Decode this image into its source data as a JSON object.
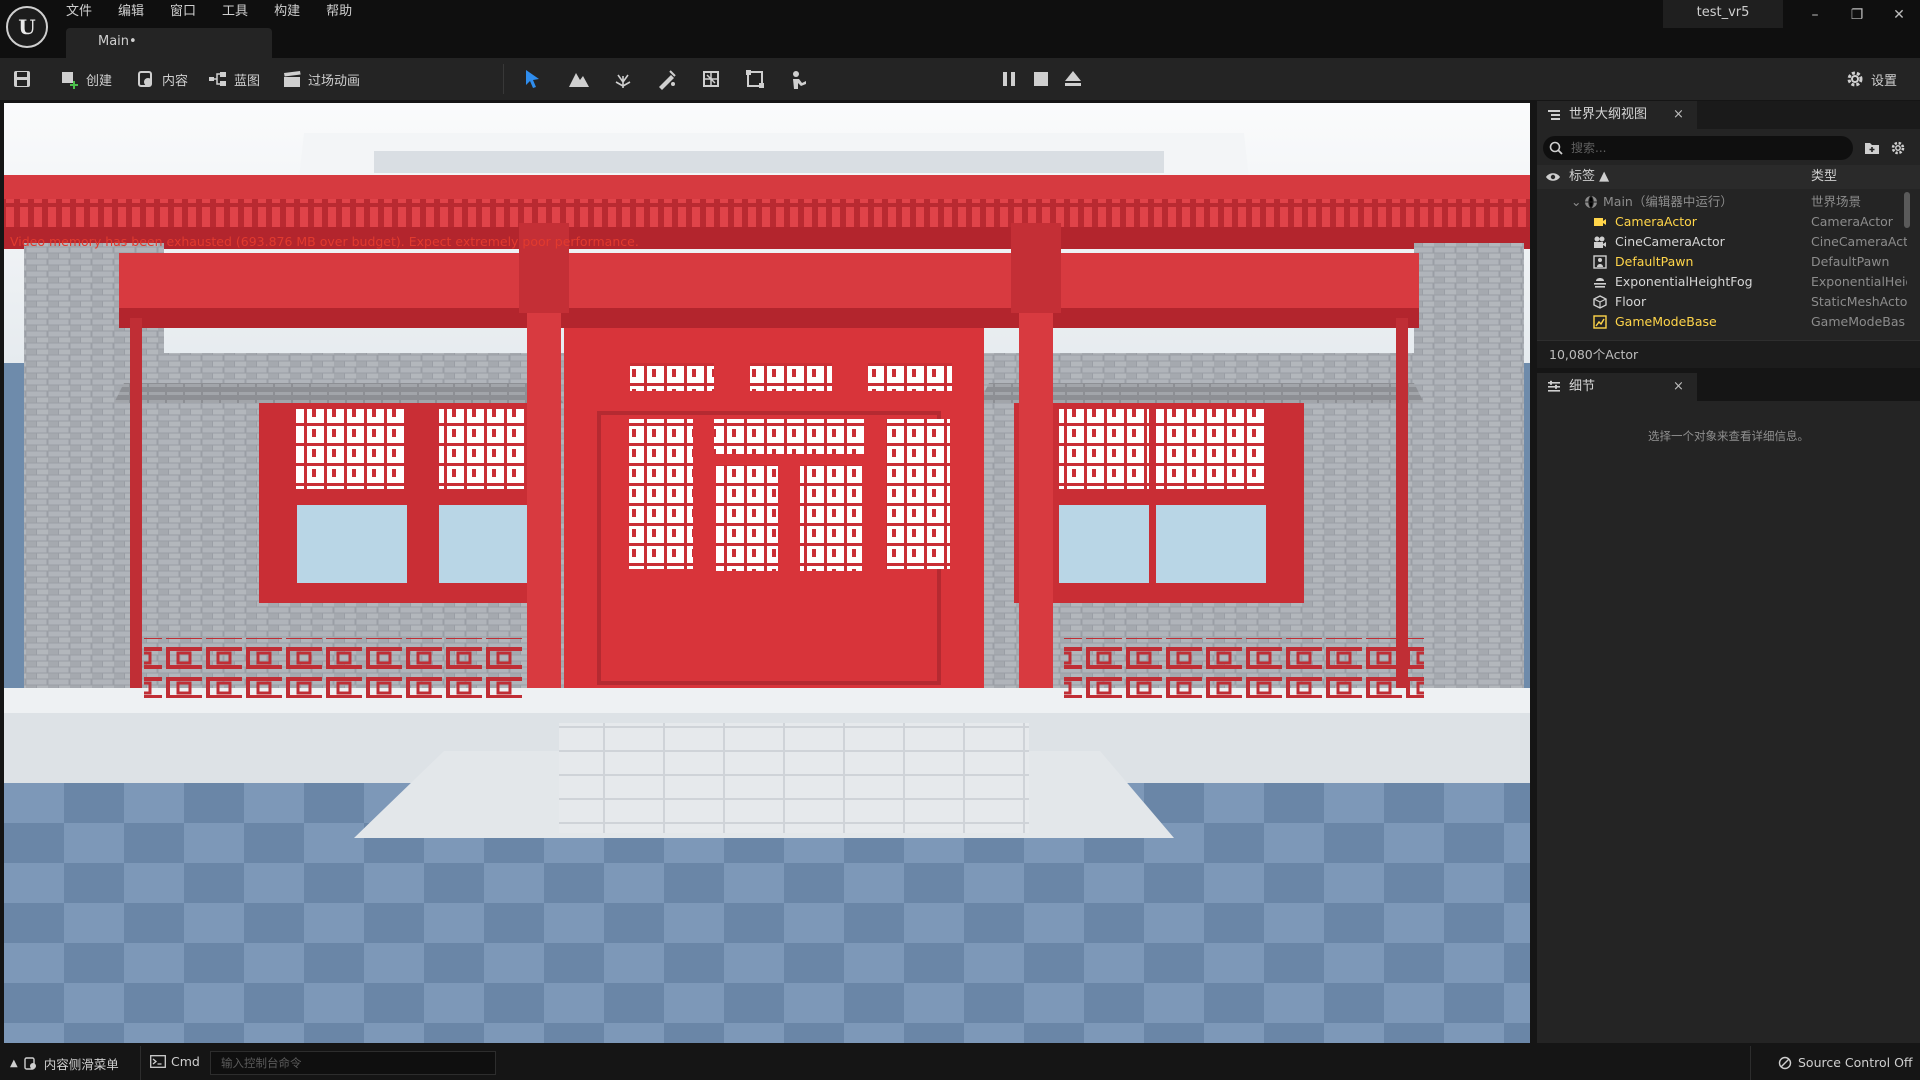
{
  "menu": [
    "文件",
    "编辑",
    "窗口",
    "工具",
    "构建",
    "帮助"
  ],
  "logo": "U",
  "document_tab": "Main•",
  "project_tab": "test_vr5",
  "window": {
    "minimize": "–",
    "restore": "❐",
    "close": "✕"
  },
  "toolbar": {
    "create": "创建",
    "content": "内容",
    "blueprint": "蓝图",
    "cinematics": "过场动画",
    "settings": "设置"
  },
  "viewport": {
    "warning": "Video memory has been exhausted (693.876 MB over budget). Expect extremely poor performance."
  },
  "outliner": {
    "tab_title": "世界大纲视图",
    "close": "×",
    "search_placeholder": "搜索...",
    "col_label": "标签 ▲",
    "col_type": "类型",
    "root": {
      "label": "Main（编辑器中运行）",
      "type": "世界场景"
    },
    "rows": [
      {
        "label": "CameraActor",
        "type": "CameraActor",
        "highlight": true,
        "icon": "camera-icon"
      },
      {
        "label": "CineCameraActor",
        "type": "CineCameraAct",
        "highlight": false,
        "icon": "cine-camera-icon"
      },
      {
        "label": "DefaultPawn",
        "type": "DefaultPawn",
        "highlight": true,
        "icon": "pawn-icon"
      },
      {
        "label": "ExponentialHeightFog",
        "type": "ExponentialHeig",
        "highlight": false,
        "icon": "fog-icon"
      },
      {
        "label": "Floor",
        "type": "StaticMeshActo",
        "highlight": false,
        "icon": "static-mesh-icon"
      },
      {
        "label": "GameModeBase",
        "type": "GameModeBas",
        "highlight": true,
        "icon": "game-mode-icon"
      }
    ],
    "count": "10,080个Actor"
  },
  "details": {
    "tab_title": "细节",
    "close": "×",
    "empty_text": "选择一个对象来查看详细信息。"
  },
  "statusbar": {
    "content_drawer": "内容侧滑菜单",
    "cmd": "Cmd",
    "cmd_placeholder": "输入控制台命令",
    "source_control": "Source Control Off"
  },
  "colors": {
    "accent_blue": "#2f8ded",
    "actor_yellow": "#ffd54a",
    "warning_red": "#e23a2e",
    "pillar_red": "#d8343a"
  }
}
